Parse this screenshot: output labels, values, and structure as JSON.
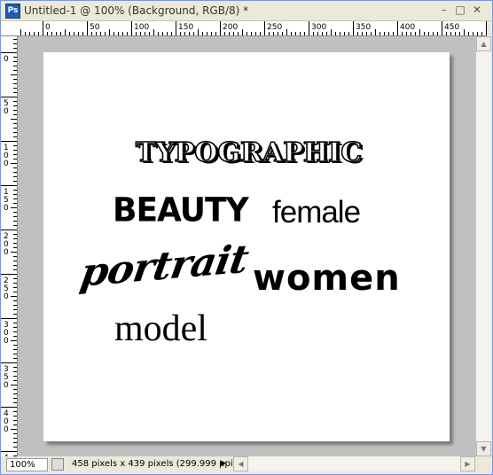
{
  "window": {
    "app_icon_text": "Ps",
    "title": "Untitled-1 @ 100% (Background, RGB/8) *",
    "minimize_glyph": "–",
    "maximize_glyph": "□",
    "close_glyph": "✕"
  },
  "ruler_h": {
    "labels": [
      "0",
      "50",
      "100",
      "150",
      "200",
      "250",
      "300",
      "350",
      "400",
      "450"
    ]
  },
  "ruler_v": {
    "labels": [
      "0",
      "50",
      "100",
      "150",
      "200",
      "250",
      "300",
      "350",
      "400",
      "450"
    ]
  },
  "document": {
    "words": {
      "typographic": "TYPOGRAPHIC",
      "beauty": "BEAUTY",
      "female": "female",
      "portrait": "portrait",
      "women": "women",
      "model": "model"
    }
  },
  "status": {
    "zoom": "100%",
    "info": "458 pixels x 439 pixels (299.999 ppi)",
    "arrow_glyph": "▶"
  },
  "scroll": {
    "up": "▲",
    "down": "▼",
    "left": "◀",
    "right": "▶"
  }
}
